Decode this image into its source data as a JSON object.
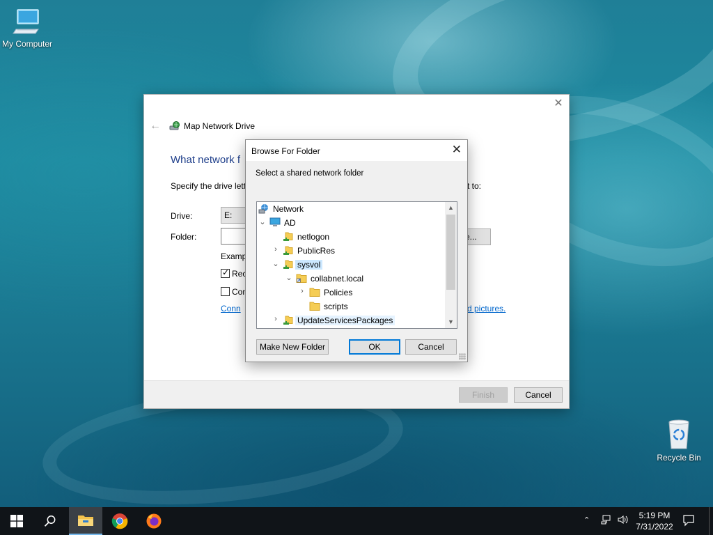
{
  "desktop": {
    "icons": [
      {
        "label": "My Computer",
        "icon": "computer-icon"
      },
      {
        "label": "Recycle Bin",
        "icon": "recycle-bin-icon"
      }
    ]
  },
  "map_drive": {
    "title": "Map Network Drive",
    "heading": "What network f",
    "specify_text": "Specify the drive lett",
    "specify_tail": "t to:",
    "drive_label": "Drive:",
    "drive_value": "E:",
    "folder_label": "Folder:",
    "folder_value": "",
    "browse_label": "e...",
    "example_text": "Examp",
    "reconnect_label": "Rec",
    "reconnect_checked": true,
    "credentials_label": "Con",
    "credentials_checked": false,
    "link_text": "Conn",
    "link_tail": "d pictures.",
    "finish_label": "Finish",
    "cancel_label": "Cancel"
  },
  "browse_dialog": {
    "title": "Browse For Folder",
    "instruction": "Select a shared network folder",
    "tree": [
      {
        "label": "Network",
        "icon": "network-icon",
        "expander": "",
        "level": 0
      },
      {
        "label": "AD",
        "icon": "computer-icon",
        "expander": "expanded",
        "level": 1
      },
      {
        "label": "netlogon",
        "icon": "shared-folder-icon",
        "expander": "",
        "level": 2
      },
      {
        "label": "PublicRes",
        "icon": "shared-folder-icon",
        "expander": "collapsed",
        "level": 2
      },
      {
        "label": "sysvol",
        "icon": "shared-folder-icon",
        "expander": "expanded",
        "level": 2,
        "selected": true
      },
      {
        "label": "collabnet.local",
        "icon": "folder-shortcut-icon",
        "expander": "expanded",
        "level": 3
      },
      {
        "label": "Policies",
        "icon": "folder-icon",
        "expander": "collapsed",
        "level": 4
      },
      {
        "label": "scripts",
        "icon": "folder-icon",
        "expander": "",
        "level": 4
      },
      {
        "label": "UpdateServicesPackages",
        "icon": "shared-folder-icon",
        "expander": "collapsed",
        "level": 2,
        "hover": true
      }
    ],
    "make_folder_label": "Make New Folder",
    "ok_label": "OK",
    "cancel_label": "Cancel"
  },
  "taskbar": {
    "apps": [
      "start-icon",
      "search-icon",
      "file-explorer-icon",
      "chrome-icon",
      "firefox-icon"
    ],
    "active_app": "file-explorer-icon",
    "time": "5:19 PM",
    "date": "7/31/2022"
  }
}
